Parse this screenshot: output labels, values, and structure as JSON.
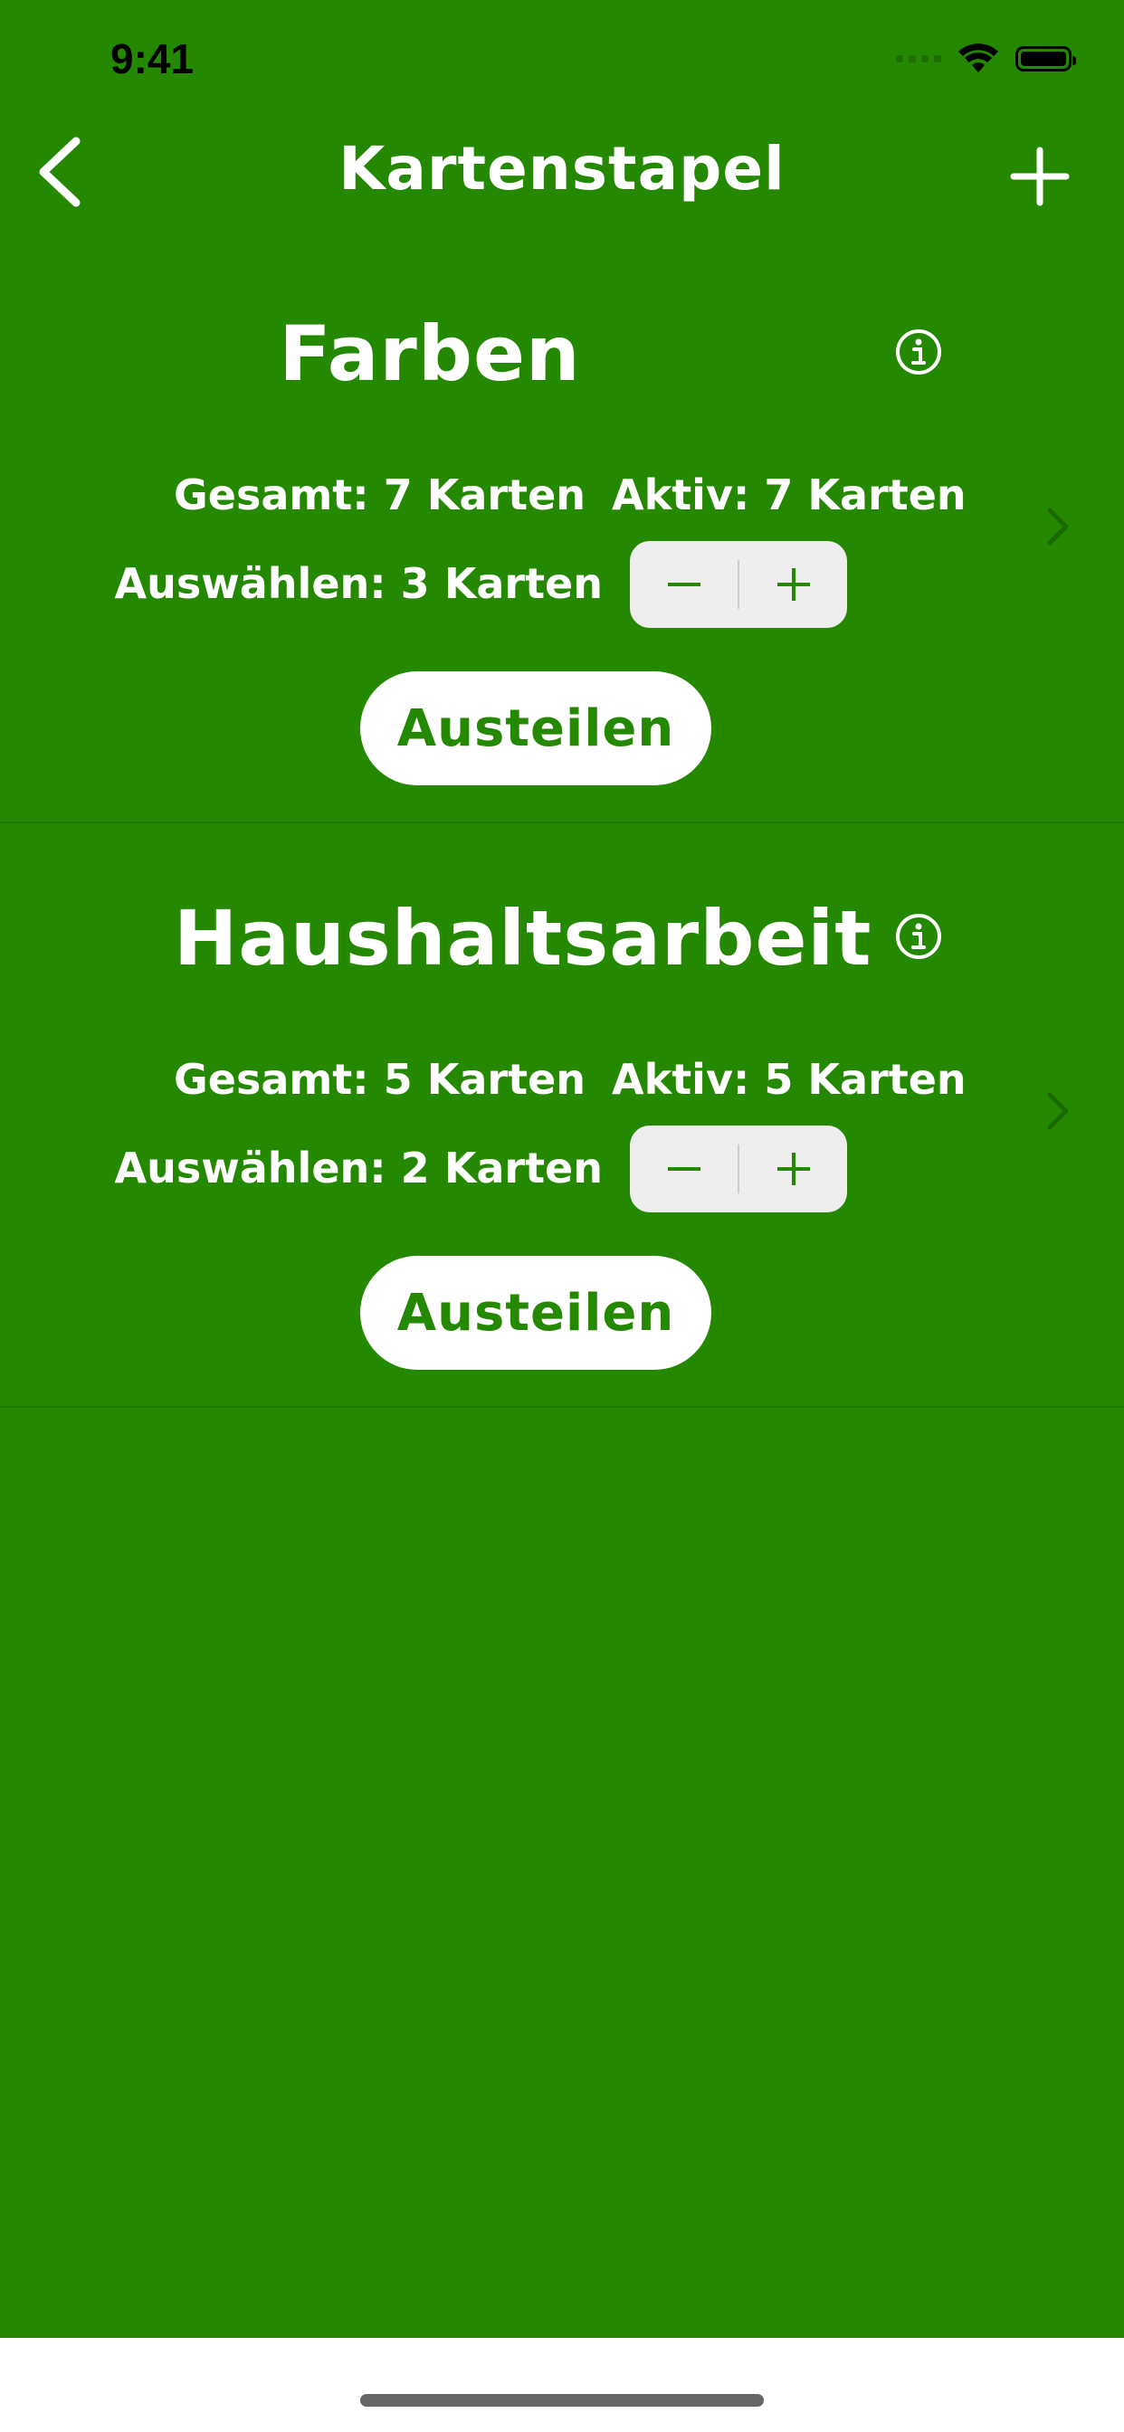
{
  "status_bar": {
    "time": "9:41"
  },
  "nav": {
    "title": "Kartenstapel",
    "back_icon": "chevron-left-icon",
    "add_icon": "plus-icon"
  },
  "decks": [
    {
      "title": "Farben",
      "total": "Gesamt: 7 Karten",
      "active": "Aktiv: 7 Karten",
      "select": "Auswählen: 3 Karten",
      "deal_label": "Austeilen"
    },
    {
      "title": "Haushaltsarbeit",
      "total": "Gesamt: 5 Karten",
      "active": "Aktiv: 5 Karten",
      "select": "Auswählen: 2 Karten",
      "deal_label": "Austeilen"
    }
  ],
  "colors": {
    "background": "#248800",
    "button": "#ffffff",
    "button_text": "#248800",
    "stepper": "#eeeeee"
  }
}
